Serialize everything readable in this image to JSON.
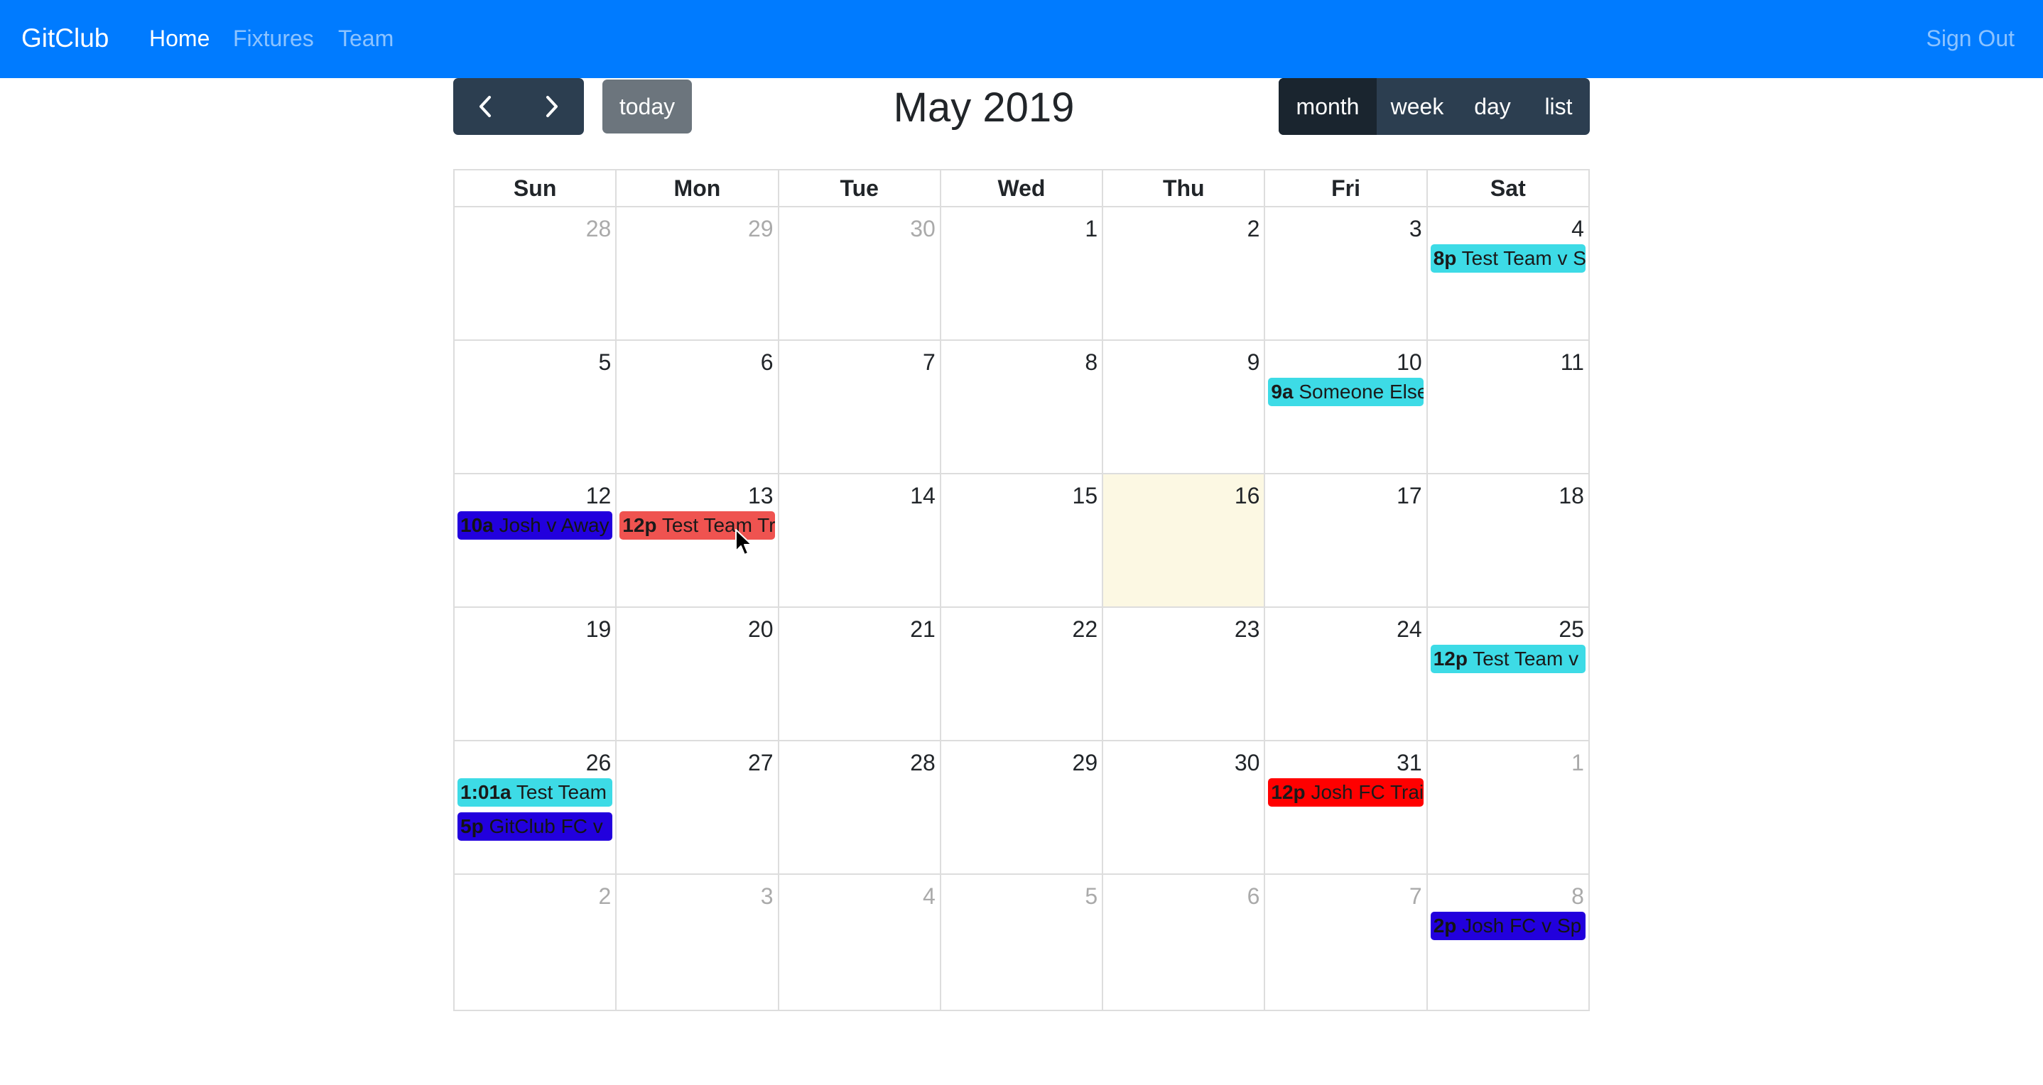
{
  "navbar": {
    "brand": "GitClub",
    "links": [
      {
        "label": "Home",
        "active": true
      },
      {
        "label": "Fixtures",
        "active": false
      },
      {
        "label": "Team",
        "active": false
      }
    ],
    "sign_out": "Sign Out",
    "color": "#007bff"
  },
  "toolbar": {
    "prev_icon": "chevron-left-icon",
    "next_icon": "chevron-right-icon",
    "today": "today",
    "title": "May 2019",
    "views": [
      {
        "label": "month",
        "active": true
      },
      {
        "label": "week",
        "active": false
      },
      {
        "label": "day",
        "active": false
      },
      {
        "label": "list",
        "active": false
      }
    ]
  },
  "calendar": {
    "day_headers": [
      "Sun",
      "Mon",
      "Tue",
      "Wed",
      "Thu",
      "Fri",
      "Sat"
    ],
    "weeks": [
      {
        "days": [
          {
            "num": "28",
            "other": true,
            "events": []
          },
          {
            "num": "29",
            "other": true,
            "events": []
          },
          {
            "num": "30",
            "other": true,
            "events": []
          },
          {
            "num": "1",
            "other": false,
            "events": []
          },
          {
            "num": "2",
            "other": false,
            "events": []
          },
          {
            "num": "3",
            "other": false,
            "events": []
          },
          {
            "num": "4",
            "other": false,
            "events": [
              {
                "time": "8p",
                "title": "Test Team v S",
                "color": "cyan"
              }
            ]
          }
        ]
      },
      {
        "days": [
          {
            "num": "5",
            "other": false,
            "events": []
          },
          {
            "num": "6",
            "other": false,
            "events": []
          },
          {
            "num": "7",
            "other": false,
            "events": []
          },
          {
            "num": "8",
            "other": false,
            "events": []
          },
          {
            "num": "9",
            "other": false,
            "events": []
          },
          {
            "num": "10",
            "other": false,
            "events": [
              {
                "time": "9a",
                "title": "Someone Else",
                "color": "cyan"
              }
            ]
          },
          {
            "num": "11",
            "other": false,
            "events": []
          }
        ]
      },
      {
        "days": [
          {
            "num": "12",
            "other": false,
            "events": [
              {
                "time": "10a",
                "title": "Josh v Away",
                "color": "blue"
              }
            ]
          },
          {
            "num": "13",
            "other": false,
            "events": [
              {
                "time": "12p",
                "title": "Test Team Tr",
                "color": "salmon"
              }
            ]
          },
          {
            "num": "14",
            "other": false,
            "events": []
          },
          {
            "num": "15",
            "other": false,
            "events": []
          },
          {
            "num": "16",
            "other": false,
            "today": true,
            "events": []
          },
          {
            "num": "17",
            "other": false,
            "events": []
          },
          {
            "num": "18",
            "other": false,
            "events": []
          }
        ]
      },
      {
        "days": [
          {
            "num": "19",
            "other": false,
            "events": []
          },
          {
            "num": "20",
            "other": false,
            "events": []
          },
          {
            "num": "21",
            "other": false,
            "events": []
          },
          {
            "num": "22",
            "other": false,
            "events": []
          },
          {
            "num": "23",
            "other": false,
            "events": []
          },
          {
            "num": "24",
            "other": false,
            "events": []
          },
          {
            "num": "25",
            "other": false,
            "events": [
              {
                "time": "12p",
                "title": "Test Team v",
                "color": "cyan"
              }
            ]
          }
        ]
      },
      {
        "days": [
          {
            "num": "26",
            "other": false,
            "events": [
              {
                "time": "1:01a",
                "title": "Test Team",
                "color": "cyan"
              },
              {
                "time": "5p",
                "title": "GitClub FC v",
                "color": "blue"
              }
            ]
          },
          {
            "num": "27",
            "other": false,
            "events": []
          },
          {
            "num": "28",
            "other": false,
            "events": []
          },
          {
            "num": "29",
            "other": false,
            "events": []
          },
          {
            "num": "30",
            "other": false,
            "events": []
          },
          {
            "num": "31",
            "other": false,
            "events": [
              {
                "time": "12p",
                "title": "Josh FC Trai",
                "color": "red"
              }
            ]
          },
          {
            "num": "1",
            "other": true,
            "events": []
          }
        ]
      },
      {
        "days": [
          {
            "num": "2",
            "other": true,
            "events": []
          },
          {
            "num": "3",
            "other": true,
            "events": []
          },
          {
            "num": "4",
            "other": true,
            "events": []
          },
          {
            "num": "5",
            "other": true,
            "events": []
          },
          {
            "num": "6",
            "other": true,
            "events": []
          },
          {
            "num": "7",
            "other": true,
            "events": []
          },
          {
            "num": "8",
            "other": true,
            "events": [
              {
                "time": "2p",
                "title": "Josh FC v Sp",
                "color": "blue"
              }
            ]
          }
        ]
      }
    ]
  }
}
